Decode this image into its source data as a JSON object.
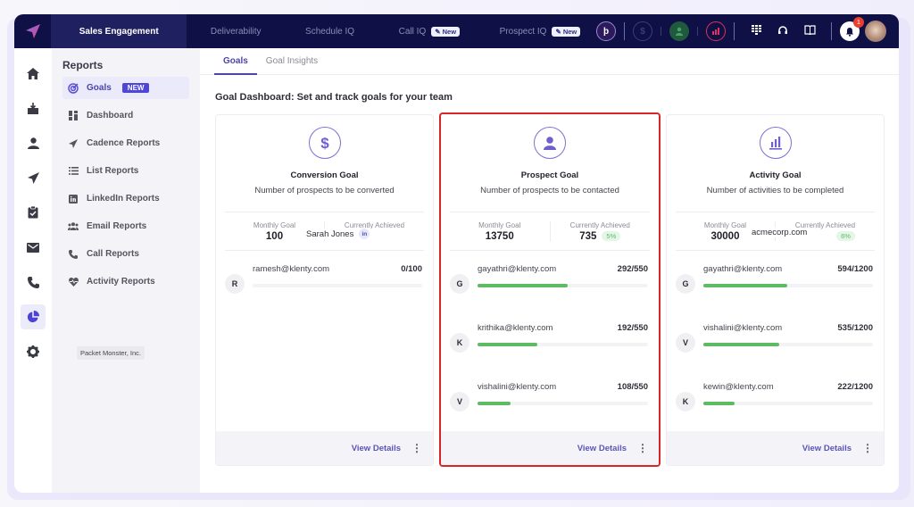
{
  "topnav": {
    "tabs": [
      {
        "label": "Sales Engagement",
        "active": true
      },
      {
        "label": "Deliverability"
      },
      {
        "label": "Schedule IQ"
      },
      {
        "label": "Call IQ",
        "badge": "New"
      },
      {
        "label": "Prospect IQ",
        "badge": "New"
      }
    ],
    "badge_prefix": "✎",
    "notification_count": "1",
    "icons": [
      "brand-p-icon",
      "dollar-icon",
      "user-icon",
      "chart-icon",
      "dialpad-icon",
      "headset-icon",
      "book-icon",
      "bell-icon",
      "profile-avatar"
    ],
    "colors": {
      "bar": "#0f1045",
      "active_tab": "#1e2060"
    }
  },
  "rail": {
    "icons": [
      "home-icon",
      "inbox-icon",
      "person-icon",
      "send-icon",
      "clipboard-icon",
      "mail-icon",
      "phone-icon",
      "pie-chart-icon",
      "settings-icon"
    ],
    "active": "pie-chart-icon"
  },
  "sidebar": {
    "title": "Reports",
    "items": [
      {
        "label": "Goals",
        "badge": "NEW",
        "active": true
      },
      {
        "label": "Dashboard"
      },
      {
        "label": "Cadence Reports"
      },
      {
        "label": "List Reports"
      },
      {
        "label": "LinkedIn Reports"
      },
      {
        "label": "Email Reports"
      },
      {
        "label": "Call Reports"
      },
      {
        "label": "Activity Reports"
      }
    ],
    "org_label": "Packet Monster, Inc."
  },
  "main": {
    "tabs": [
      {
        "label": "Goals",
        "active": true
      },
      {
        "label": "Goal Insights"
      }
    ],
    "title": "Goal Dashboard: Set and track goals for your team",
    "monthly_label": "Monthly Goal",
    "achieved_label": "Currently Achieved",
    "view_details": "View Details",
    "cards": [
      {
        "name": "Conversion Goal",
        "description": "Number of prospects to be converted",
        "icon": "dollar-icon",
        "monthly_goal": "100",
        "achieved": "",
        "percent": "",
        "overlay": {
          "text": "Sarah Jones",
          "badge": "in"
        },
        "rows": [
          {
            "initial": "R",
            "email": "ramesh@klenty.com",
            "count": "0/100",
            "progress": 0
          }
        ]
      },
      {
        "name": "Prospect Goal",
        "description": "Number of prospects to be contacted",
        "icon": "user-icon",
        "monthly_goal": "13750",
        "achieved": "735",
        "percent": "5%",
        "highlighted": true,
        "rows": [
          {
            "initial": "G",
            "email": "gayathri@klenty.com",
            "count": "292/550",
            "progress": 0.531
          },
          {
            "initial": "K",
            "email": "krithika@klenty.com",
            "count": "192/550",
            "progress": 0.349
          },
          {
            "initial": "V",
            "email": "vishalini@klenty.com",
            "count": "108/550",
            "progress": 0.196
          }
        ]
      },
      {
        "name": "Activity Goal",
        "description": "Number of activities to be completed",
        "icon": "bar-chart-icon",
        "monthly_goal": "30000",
        "achieved": "",
        "percent": "6%",
        "overlay": {
          "text": "acmecorp.com"
        },
        "rows": [
          {
            "initial": "G",
            "email": "gayathri@klenty.com",
            "count": "594/1200",
            "progress": 0.495
          },
          {
            "initial": "V",
            "email": "vishalini@klenty.com",
            "count": "535/1200",
            "progress": 0.446
          },
          {
            "initial": "K",
            "email": "kewin@klenty.com",
            "count": "222/1200",
            "progress": 0.185
          }
        ]
      }
    ]
  }
}
